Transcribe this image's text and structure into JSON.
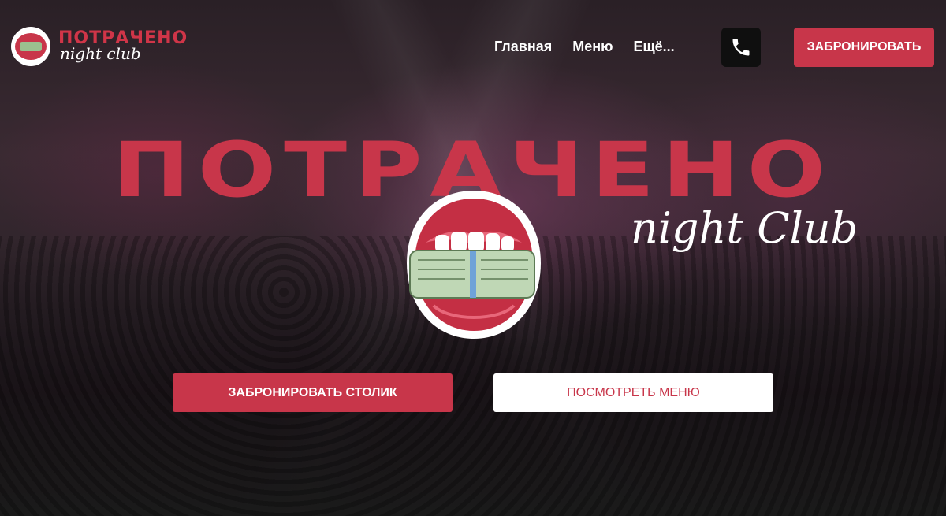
{
  "brand": {
    "title": "ПОТРАЧЕНО",
    "subtitle": "night club",
    "accent_color": "#c8364a"
  },
  "nav": {
    "items": [
      {
        "label": "Главная"
      },
      {
        "label": "Меню"
      },
      {
        "label": "Ещё..."
      }
    ]
  },
  "header": {
    "phone_icon": "phone-icon",
    "book_label": "ЗАБРОНИРОВАТЬ"
  },
  "hero": {
    "title": "ПОТРАЧЕНО",
    "subtitle": "night Club",
    "sticker_icon": "lips-money-icon",
    "primary_cta": "ЗАБРОНИРОВАТЬ СТОЛИК",
    "secondary_cta": "ПОСМОТРЕТЬ МЕНЮ"
  }
}
